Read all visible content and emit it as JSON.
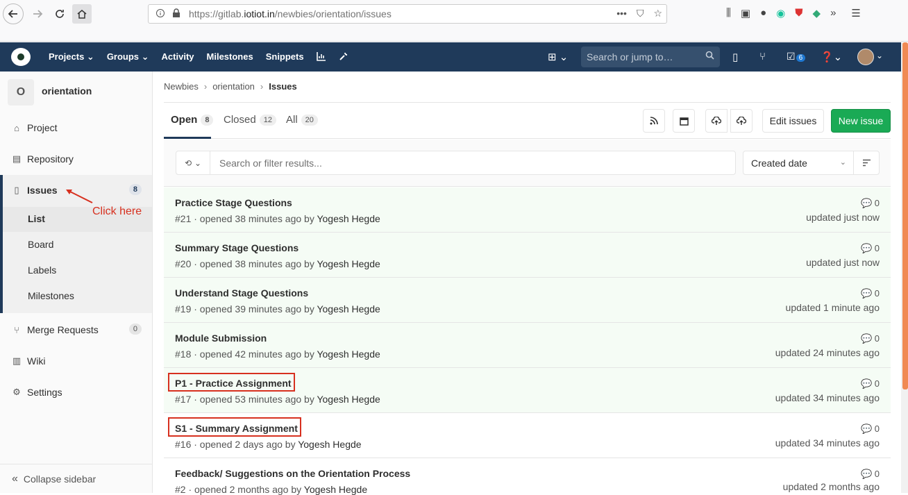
{
  "browser": {
    "url_prefix": "https://gitlab.",
    "url_domain": "iotiot.in",
    "url_path": "/newbies/orientation/issues"
  },
  "header": {
    "nav": [
      "Projects ⌄",
      "Groups ⌄",
      "Activity",
      "Milestones",
      "Snippets"
    ],
    "search_placeholder": "Search or jump to…",
    "todo_count": "6"
  },
  "sidebar": {
    "project_initial": "O",
    "project_name": "orientation",
    "items": [
      {
        "label": "Project"
      },
      {
        "label": "Repository"
      },
      {
        "label": "Issues",
        "count": "8"
      },
      {
        "label": "Merge Requests",
        "count": "0"
      },
      {
        "label": "Wiki"
      },
      {
        "label": "Settings"
      }
    ],
    "issues_sub": [
      "List",
      "Board",
      "Labels",
      "Milestones"
    ],
    "collapse_label": "Collapse sidebar",
    "annotation": "Click here"
  },
  "breadcrumb": [
    "Newbies",
    "orientation",
    "Issues"
  ],
  "tabs": [
    {
      "label": "Open",
      "count": "8"
    },
    {
      "label": "Closed",
      "count": "12"
    },
    {
      "label": "All",
      "count": "20"
    }
  ],
  "actions": {
    "edit": "Edit issues",
    "new": "New issue"
  },
  "filter": {
    "placeholder": "Search or filter results...",
    "sort": "Created date"
  },
  "issues": [
    {
      "title": "Practice Stage Questions",
      "ref": "#21 · opened 38 minutes ago by ",
      "author": "Yogesh Hegde",
      "comments": "0",
      "updated": "updated just now"
    },
    {
      "title": "Summary Stage Questions",
      "ref": "#20 · opened 38 minutes ago by ",
      "author": "Yogesh Hegde",
      "comments": "0",
      "updated": "updated just now"
    },
    {
      "title": "Understand Stage Questions",
      "ref": "#19 · opened 39 minutes ago by ",
      "author": "Yogesh Hegde",
      "comments": "0",
      "updated": "updated 1 minute ago"
    },
    {
      "title": "Module Submission",
      "ref": "#18 · opened 42 minutes ago by ",
      "author": "Yogesh Hegde",
      "comments": "0",
      "updated": "updated 24 minutes ago"
    },
    {
      "title": "P1 - Practice Assignment",
      "ref": "#17 · opened 53 minutes ago by ",
      "author": "Yogesh Hegde",
      "comments": "0",
      "updated": "updated 34 minutes ago"
    },
    {
      "title": "S1 - Summary Assignment",
      "ref": "#16 · opened 2 days ago by ",
      "author": "Yogesh Hegde",
      "comments": "0",
      "updated": "updated 34 minutes ago"
    },
    {
      "title": "Feedback/ Suggestions on the Orientation Process",
      "ref": "#2 · opened 2 months ago by ",
      "author": "Yogesh Hegde",
      "comments": "0",
      "updated": "updated 2 months ago"
    }
  ]
}
